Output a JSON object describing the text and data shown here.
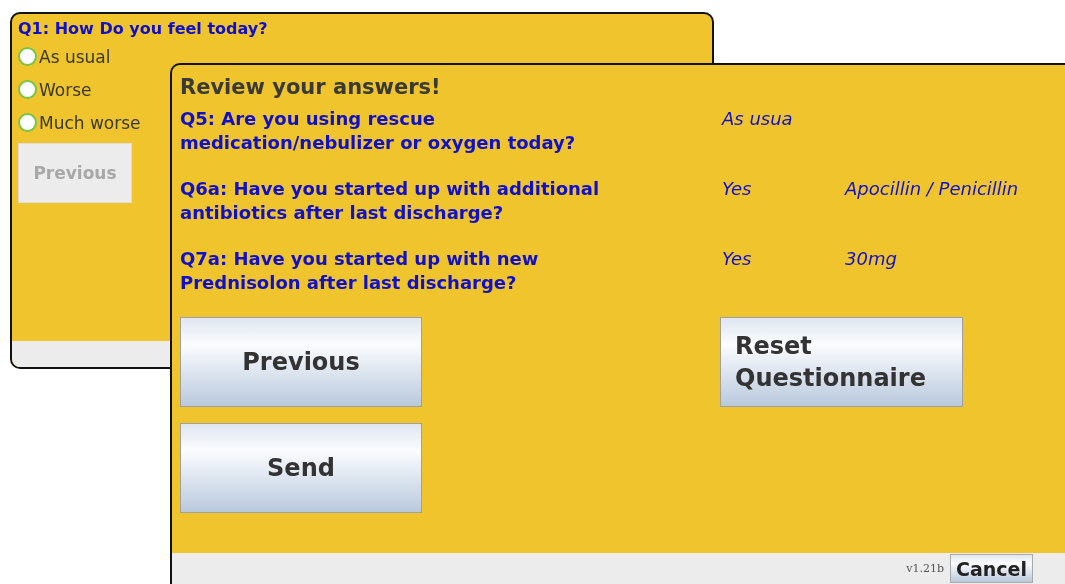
{
  "back_window": {
    "question": "Q1: How Do you feel today?",
    "options": [
      {
        "label": "As usual",
        "selected": false
      },
      {
        "label": "Worse",
        "selected": false
      },
      {
        "label": "Much worse",
        "selected": false
      }
    ],
    "previous_button": {
      "label": "Previous",
      "disabled": true
    }
  },
  "review_window": {
    "title": "Review your answers!",
    "answers": [
      {
        "question": "Q5: Are you using rescue medication/nebulizer or oxygen today?",
        "answer": "As usua"
      },
      {
        "question": "Q6a: Have you started up with additional antibiotics after last discharge?",
        "answer": "Yes",
        "detail": "Apocillin / Penicillin"
      },
      {
        "question": "Q7a: Have you started up with new Prednisolon after last discharge?",
        "answer": "Yes",
        "detail": "30mg"
      }
    ],
    "buttons": {
      "previous": "Previous",
      "send": "Send",
      "reset": "Reset Questionnaire"
    },
    "version": "v1.21b",
    "cancel": "Cancel"
  }
}
